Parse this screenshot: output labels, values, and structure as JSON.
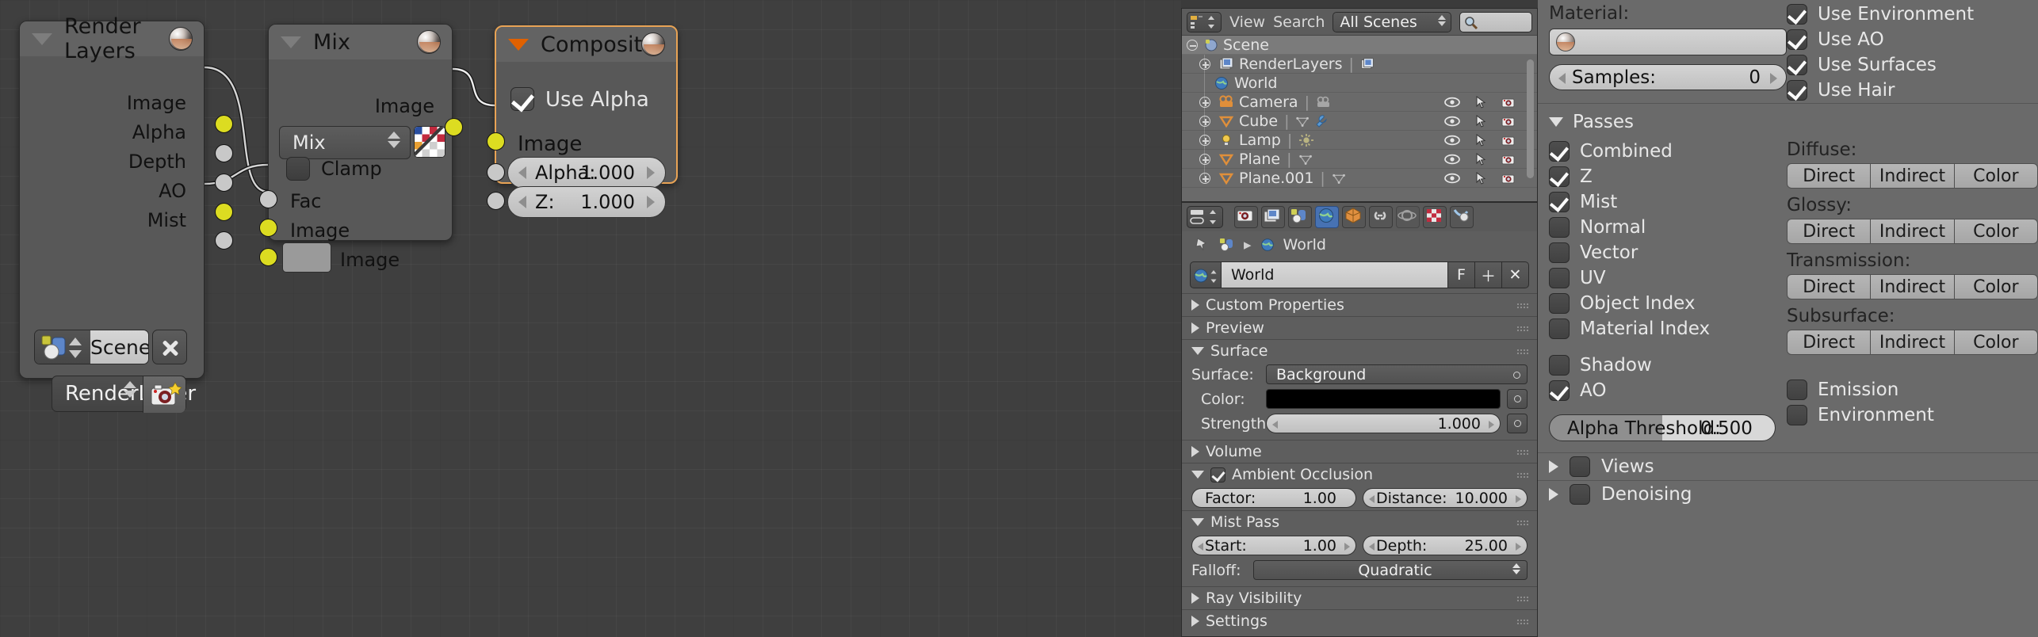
{
  "node_editor": {
    "nodes": [
      {
        "name": "Render Layers",
        "title": "Render Layers",
        "outputs": [
          "Image",
          "Alpha",
          "Depth",
          "AO",
          "Mist"
        ],
        "scene_label": "Scene",
        "layer_label": "RenderLayer"
      },
      {
        "name": "Mix",
        "title": "Mix",
        "output_label": "Image",
        "blend_mode": "Mix",
        "clamp_label": "Clamp",
        "inputs": [
          "Fac",
          "Image",
          "Image"
        ]
      },
      {
        "name": "Composite",
        "title": "Composite",
        "use_alpha_label": "Use Alpha",
        "image_label": "Image",
        "alpha_label": "Alpha:",
        "alpha_value": "1.000",
        "z_label": "Z:",
        "z_value": "1.000"
      }
    ]
  },
  "outliner": {
    "header": {
      "view_menu": "View",
      "search_menu": "Search",
      "scope": "All Scenes"
    },
    "rows": [
      {
        "label": "Scene",
        "icon": "scene-icon",
        "indent": 0,
        "expand": "minus",
        "selected": true
      },
      {
        "label": "RenderLayers",
        "icon": "renderlayers-icon",
        "indent": 1,
        "expand": "plus",
        "selected": false
      },
      {
        "label": "World",
        "icon": "world-icon",
        "indent": 1,
        "expand": "none",
        "selected": false
      },
      {
        "label": "Camera",
        "icon": "camera-icon",
        "indent": 1,
        "expand": "plus",
        "selected": false
      },
      {
        "label": "Cube",
        "icon": "mesh-icon",
        "indent": 1,
        "expand": "plus",
        "selected": false
      },
      {
        "label": "Lamp",
        "icon": "lamp-icon",
        "indent": 1,
        "expand": "plus",
        "selected": false
      },
      {
        "label": "Plane",
        "icon": "mesh-icon",
        "indent": 1,
        "expand": "plus",
        "selected": false
      },
      {
        "label": "Plane.001",
        "icon": "mesh-icon",
        "indent": 1,
        "expand": "plus",
        "selected": false
      }
    ]
  },
  "properties": {
    "breadcrumb_label": "World",
    "id_name": "World",
    "id_f_label": "F",
    "panels": {
      "custom_properties": "Custom Properties",
      "preview": "Preview",
      "surface": "Surface",
      "volume": "Volume",
      "ambient_occlusion": "Ambient Occlusion",
      "mist_pass": "Mist Pass",
      "ray_visibility": "Ray Visibility",
      "settings": "Settings"
    },
    "surface": {
      "surface_label": "Surface:",
      "surface_value": "Background",
      "color_label": "Color:",
      "color_value": "#000000",
      "strength_label": "Strength:",
      "strength_value": "1.000"
    },
    "ao": {
      "factor_label": "Factor:",
      "factor_value": "1.00",
      "distance_label": "Distance:",
      "distance_value": "10.000"
    },
    "mist": {
      "start_label": "Start:",
      "start_value": "1.00",
      "depth_label": "Depth:",
      "depth_value": "25.00",
      "falloff_label": "Falloff:",
      "falloff_value": "Quadratic"
    }
  },
  "render_layer": {
    "material_label": "Material:",
    "material_value": "",
    "samples_label": "Samples:",
    "samples_value": "0",
    "use_toggles": [
      {
        "label": "Use Environment",
        "checked": true
      },
      {
        "label": "Use AO",
        "checked": true
      },
      {
        "label": "Use Surfaces",
        "checked": true
      },
      {
        "label": "Use Hair",
        "checked": true
      }
    ],
    "passes_header": "Passes",
    "passes": [
      {
        "label": "Combined",
        "checked": true
      },
      {
        "label": "Z",
        "checked": true
      },
      {
        "label": "Mist",
        "checked": true
      },
      {
        "label": "Normal",
        "checked": false
      },
      {
        "label": "Vector",
        "checked": false
      },
      {
        "label": "UV",
        "checked": false
      },
      {
        "label": "Object Index",
        "checked": false
      },
      {
        "label": "Material Index",
        "checked": false
      }
    ],
    "passes_extra_left": [
      {
        "label": "Shadow",
        "checked": false
      },
      {
        "label": "AO",
        "checked": true
      }
    ],
    "passes_extra_right": [
      {
        "label": "Emission",
        "checked": false
      },
      {
        "label": "Environment",
        "checked": false
      }
    ],
    "light_groups": [
      {
        "label": "Diffuse:",
        "buttons": [
          "Direct",
          "Indirect",
          "Color"
        ]
      },
      {
        "label": "Glossy:",
        "buttons": [
          "Direct",
          "Indirect",
          "Color"
        ]
      },
      {
        "label": "Transmission:",
        "buttons": [
          "Direct",
          "Indirect",
          "Color"
        ]
      },
      {
        "label": "Subsurface:",
        "buttons": [
          "Direct",
          "Indirect",
          "Color"
        ]
      }
    ],
    "alpha_threshold_label": "Alpha Threshold:",
    "alpha_threshold_value": "0.500",
    "views_label": "Views",
    "denoising_label": "Denoising"
  },
  "colors": {
    "accent_orange": "#e8a355",
    "socket_yellow": "#dcdc21",
    "socket_gray": "#c8c8c8",
    "tab_active_blue": "#4772b3"
  }
}
